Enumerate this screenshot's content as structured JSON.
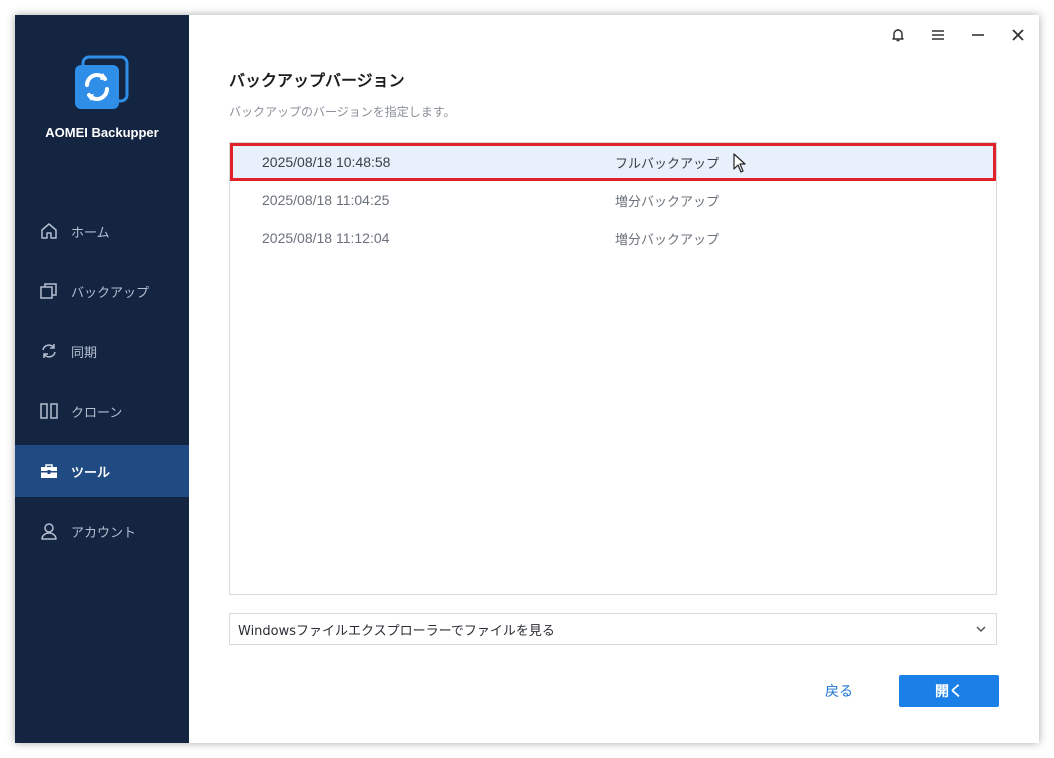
{
  "app": {
    "name": "AOMEI Backupper",
    "brand_color": "#2f8fe8"
  },
  "sidebar": {
    "items": [
      {
        "label": "ホーム",
        "icon": "home-icon",
        "active": false
      },
      {
        "label": "バックアップ",
        "icon": "backup-icon",
        "active": false
      },
      {
        "label": "同期",
        "icon": "sync-icon",
        "active": false
      },
      {
        "label": "クローン",
        "icon": "clone-icon",
        "active": false
      },
      {
        "label": "ツール",
        "icon": "toolbox-icon",
        "active": true
      },
      {
        "label": "アカウント",
        "icon": "user-icon",
        "active": false
      }
    ]
  },
  "titlebar": {
    "icons": [
      "bell-icon",
      "menu-icon",
      "minimize-icon",
      "close-icon"
    ]
  },
  "main": {
    "title": "バックアップバージョン",
    "subtitle": "バックアップのバージョンを指定します。",
    "versions": [
      {
        "date": "2025/08/18 10:48:58",
        "type": "フルバックアップ",
        "selected": true
      },
      {
        "date": "2025/08/18 11:04:25",
        "type": "増分バックアップ",
        "selected": false
      },
      {
        "date": "2025/08/18 11:12:04",
        "type": "増分バックアップ",
        "selected": false
      }
    ],
    "open_mode": {
      "selected": "Windowsファイルエクスプローラーでファイルを見る"
    },
    "back_label": "戻る",
    "open_label": "開く"
  },
  "colors": {
    "sidebar_bg": "#142542",
    "sidebar_active": "#1f4a82",
    "selection_outline": "#e02128",
    "primary_button": "#1a7fe6"
  }
}
